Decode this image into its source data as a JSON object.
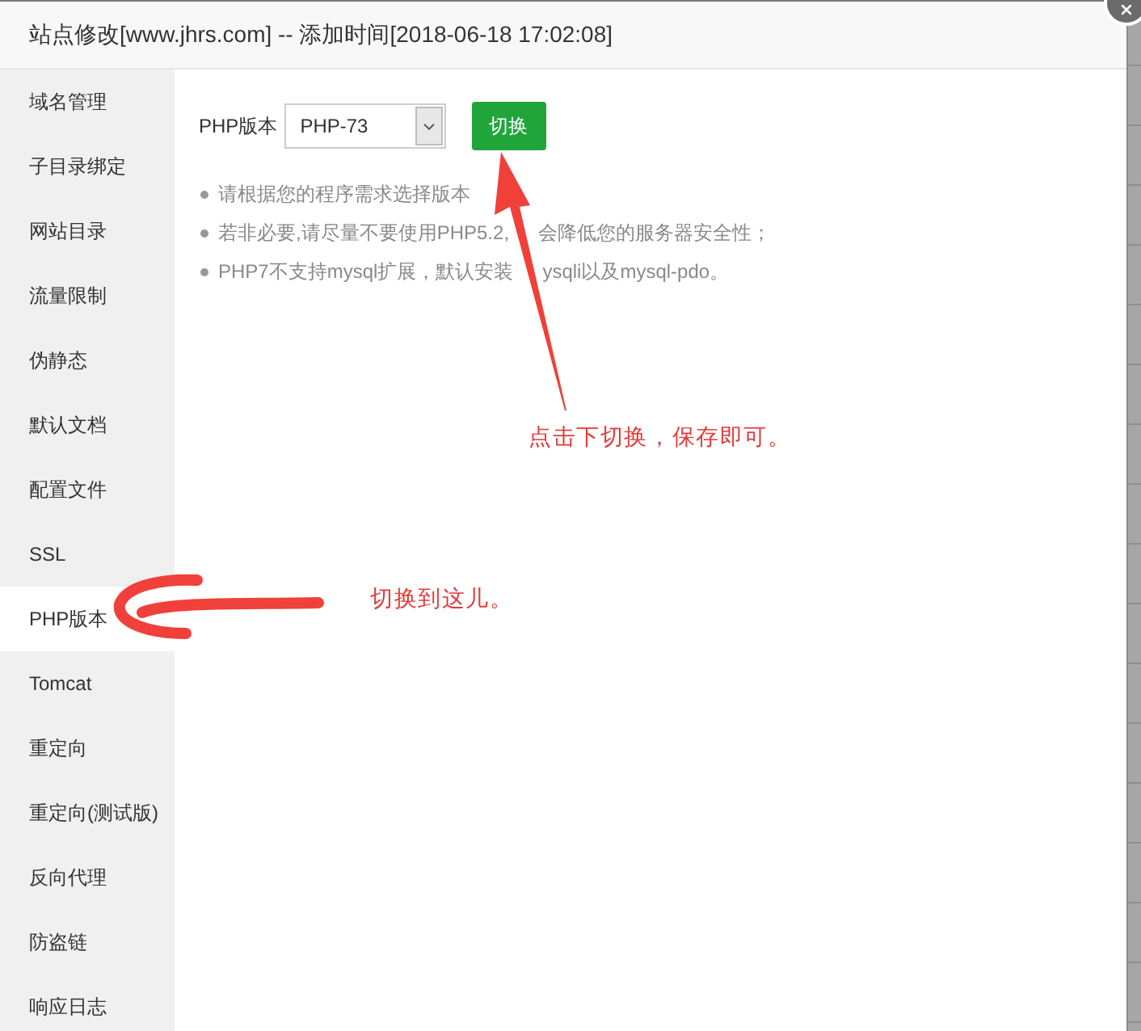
{
  "dialog": {
    "title": "站点修改[www.jhrs.com] -- 添加时间[2018-06-18 17:02:08]"
  },
  "sidebar": {
    "items": [
      {
        "label": "域名管理",
        "selected": false
      },
      {
        "label": "子目录绑定",
        "selected": false
      },
      {
        "label": "网站目录",
        "selected": false
      },
      {
        "label": "流量限制",
        "selected": false
      },
      {
        "label": "伪静态",
        "selected": false
      },
      {
        "label": "默认文档",
        "selected": false
      },
      {
        "label": "配置文件",
        "selected": false
      },
      {
        "label": "SSL",
        "selected": false
      },
      {
        "label": "PHP版本",
        "selected": true
      },
      {
        "label": "Tomcat",
        "selected": false
      },
      {
        "label": "重定向",
        "selected": false
      },
      {
        "label": "重定向(测试版)",
        "selected": false
      },
      {
        "label": "反向代理",
        "selected": false
      },
      {
        "label": "防盗链",
        "selected": false
      },
      {
        "label": "响应日志",
        "selected": false
      }
    ]
  },
  "php_version": {
    "label": "PHP版本",
    "select": {
      "value": "PHP-73"
    },
    "button": "切换"
  },
  "notes": [
    {
      "parts": [
        "请根据您的程序需求选择版本"
      ]
    },
    {
      "parts": [
        "若非必要,请尽量不要使用PHP5.2,",
        "会降低您的服务器安全性；"
      ]
    },
    {
      "parts": [
        "PHP7不支持mysql扩展，默认安装",
        "ysqli以及mysql-pdo。"
      ]
    }
  ],
  "annotations": [
    {
      "kind": "arrow",
      "text": "点击下切换，保存即可。"
    },
    {
      "kind": "stroke",
      "text": "切换到这儿。"
    }
  ]
}
